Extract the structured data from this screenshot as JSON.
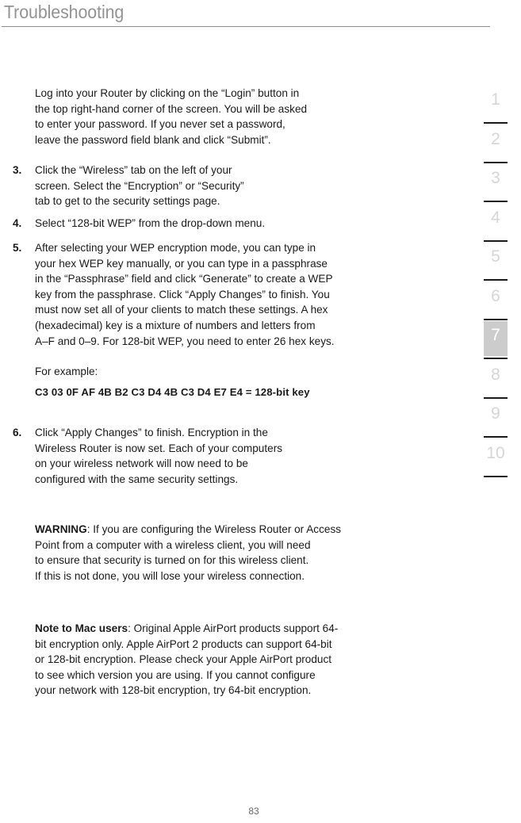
{
  "header": {
    "title": "Troubleshooting"
  },
  "section_index": {
    "tabs": [
      {
        "label": "1",
        "active": false
      },
      {
        "label": "2",
        "active": false
      },
      {
        "label": "3",
        "active": false
      },
      {
        "label": "4",
        "active": false
      },
      {
        "label": "5",
        "active": false
      },
      {
        "label": "6",
        "active": false
      },
      {
        "label": "7",
        "active": true
      },
      {
        "label": "8",
        "active": false
      },
      {
        "label": "9",
        "active": false
      },
      {
        "label": "10",
        "active": false
      }
    ],
    "active_label": "7",
    "active_color": "#cccccc",
    "inactive_color": "#d6d6d6"
  },
  "content": {
    "intro_paragraph": "Log into your Router by clicking on the “Login” button in\nthe top right-hand corner of the screen. You will be asked\nto enter your password. If you never set a password,\nleave the password field blank and click “Submit”.",
    "steps": [
      {
        "number": "3.",
        "text": "Click the “Wireless” tab on the left of your\nscreen. Select the “Encryption” or “Security”\ntab to get to the security settings page."
      },
      {
        "number": "4.",
        "text": "Select “128-bit WEP” from the drop-down menu."
      },
      {
        "number": "5.",
        "text": "After selecting your WEP encryption mode, you can type in\nyour hex WEP key manually, or you can type in a passphrase\nin the “Passphrase” field and click “Generate” to create a WEP\nkey from the passphrase. Click “Apply Changes” to finish. You\nmust now set all of your clients to match these settings. A hex\n(hexadecimal) key is a mixture of numbers and letters from\nA–F and 0–9. For 128-bit WEP, you need to enter 26 hex keys."
      },
      {
        "number": "6.",
        "text": "Click “Apply Changes” to finish. Encryption in the\nWireless Router is now set. Each of your computers\non your wireless network will now need to be\nconfigured with the same security settings."
      }
    ],
    "example_label": "For example:",
    "example_key": "C3 03 0F AF 4B B2 C3 D4 4B C3 D4 E7 E4 = 128-bit key",
    "warning": {
      "lead": "WARNING",
      "text": ": If you are configuring the Wireless Router or Access\nPoint from a computer with a wireless client, you will need\nto ensure that security is turned on for this wireless client.\nIf this is not done, you will lose your wireless connection."
    },
    "mac_note": {
      "lead": "Note to Mac users",
      "text": ": Original Apple AirPort products support 64-\nbit encryption only. Apple AirPort 2 products can support 64-bit\nor 128-bit encryption. Please check your Apple AirPort product\nto see which version you are using. If you cannot configure\nyour network with 128-bit encryption, try 64-bit encryption."
    }
  },
  "footer": {
    "page_number": "83"
  }
}
